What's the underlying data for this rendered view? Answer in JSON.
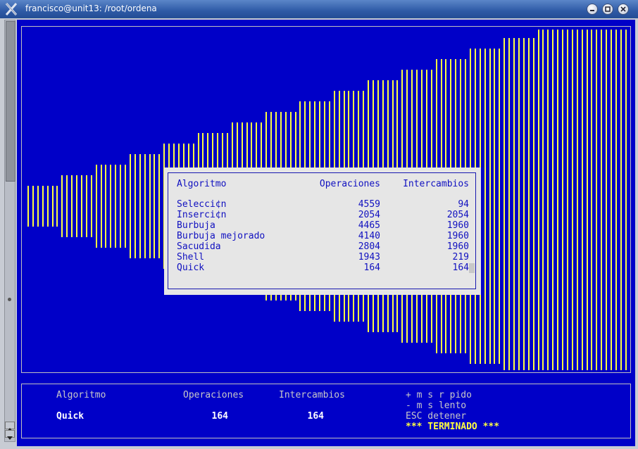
{
  "window": {
    "title": "francisco@unit13: /root/ordena"
  },
  "dialog": {
    "headers": {
      "algorithm": "Algoritmo",
      "operations": "Operaciones",
      "swaps": "Intercambios"
    },
    "rows": [
      {
        "name": "Selecci¢n",
        "operations": "4559",
        "swaps": "94"
      },
      {
        "name": "Inserci¢n",
        "operations": "2054",
        "swaps": "2054"
      },
      {
        "name": "Burbuja",
        "operations": "4465",
        "swaps": "1960"
      },
      {
        "name": "Burbuja mejorado",
        "operations": "4140",
        "swaps": "1960"
      },
      {
        "name": "Sacudida",
        "operations": "2804",
        "swaps": "1960"
      },
      {
        "name": "Shell",
        "operations": "1943",
        "swaps": "219"
      },
      {
        "name": "Quick",
        "operations": "164",
        "swaps": "164"
      }
    ]
  },
  "status": {
    "header_algorithm": "Algoritmo",
    "header_operations": "Operaciones",
    "header_swaps": "Intercambios",
    "current_algorithm": "Quick",
    "current_operations": "164",
    "current_swaps": "164",
    "help_faster": "+ m s r pido",
    "help_slower": "- m s lento",
    "help_stop": "ESC detener",
    "finished": "*** TERMINADO ***"
  },
  "colors": {
    "background": "#0000c8",
    "bars": "#ffff40",
    "dialog_bg": "#e6e6e6",
    "dialog_text": "#1010c0",
    "finished_text": "#ffff40"
  }
}
